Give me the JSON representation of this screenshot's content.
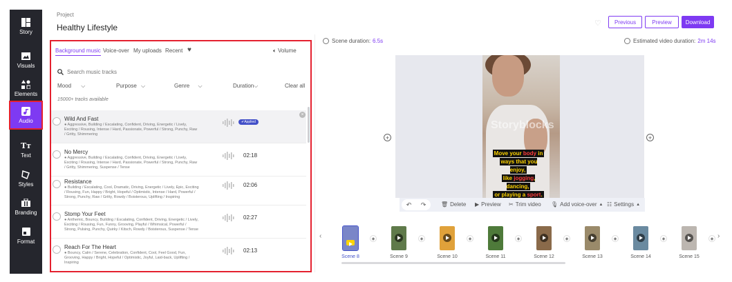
{
  "sidebar": {
    "items": [
      {
        "label": "Story",
        "icon": "story-icon"
      },
      {
        "label": "Visuals",
        "icon": "image-icon"
      },
      {
        "label": "Elements",
        "icon": "shapes-icon"
      },
      {
        "label": "Audio",
        "icon": "music-note-icon",
        "active": true
      },
      {
        "label": "Text",
        "icon": "text-icon"
      },
      {
        "label": "Styles",
        "icon": "brush-icon"
      },
      {
        "label": "Branding",
        "icon": "briefcase-icon"
      },
      {
        "label": "Format",
        "icon": "aspect-ratio-icon"
      }
    ]
  },
  "header": {
    "project_label": "Project",
    "project_title": "Healthy Lifestyle",
    "btn_previous": "Previous",
    "btn_preview": "Preview",
    "btn_download": "Download"
  },
  "audio_panel": {
    "tabs": [
      "Background music",
      "Voice-over",
      "My uploads",
      "Recent"
    ],
    "volume_label": "Volume",
    "search_placeholder": "Search music tracks",
    "filters": {
      "mood": "Mood",
      "purpose": "Purpose",
      "genre": "Genre",
      "duration": "Duration",
      "clear": "Clear all"
    },
    "count": "15000+ tracks available",
    "applied_label": "Applied",
    "tracks": [
      {
        "title": "Wild And Fast",
        "tags": "● Aggressive, Building / Escalating, Confident, Driving, Energetic / Lively, Exciting / Rousing, Intense / Hard, Passionate, Powerful / Strong, Punchy, Raw / Gritty, Shimmering",
        "duration": "",
        "applied": true
      },
      {
        "title": "No Mercy",
        "tags": "● Aggressive, Building / Escalating, Confident, Driving, Energetic / Lively, Exciting / Rousing, Intense / Hard, Passionate, Powerful / Strong, Punchy, Raw / Gritty, Shimmering, Suspense / Tense",
        "duration": "02:18"
      },
      {
        "title": "Resistance",
        "tags": "● Building / Escalating, Cool, Dramatic, Driving, Energetic / Lively, Epic, Exciting / Rousing, Fun, Happy / Bright, Hopeful / Optimistic, Intense / Hard, Powerful / Strong, Punchy, Raw / Gritty, Rowdy / Boisterous, Uplifting / Inspiring",
        "duration": "02:06"
      },
      {
        "title": "Stomp Your Feet",
        "tags": "● Anthemic, Bouncy, Building / Escalating, Confident, Driving, Energetic / Lively, Exciting / Rousing, Fun, Funny, Grooving, Playful / Whimsical, Powerful / Strong, Pulsing, Punchy, Quirky / Kitsch, Rowdy / Boisterous, Suspense / Tense",
        "duration": "02:27"
      },
      {
        "title": "Reach For The Heart",
        "tags": "● Bouncy, Calm / Serene, Celebration, Confident, Cool, Feel Good, Fun, Grooving, Happy / Bright, Hopeful / Optimistic, Joyful, Laid-back, Uplifting / Inspiring",
        "duration": "02:13"
      }
    ]
  },
  "editor": {
    "scene_duration_label": "Scene duration:",
    "scene_duration": "6.5s",
    "est_duration_label": "Estimated video duration:",
    "est_duration": "2m 14s",
    "watermark": "Storyblocks",
    "caption": {
      "l1a": "Move your ",
      "l1b": "body",
      "l1c": " in",
      "l2": "ways that you enjoy,",
      "l3a": "like ",
      "l3b": "jogging",
      "l3c": ", dancing,",
      "l4a": "or playing a ",
      "l4b": "sport",
      "l4c": "."
    },
    "toolbar": {
      "delete": "Delete",
      "preview": "Preview",
      "trim": "Trim video",
      "voiceover": "Add voice-over",
      "settings": "Settings"
    }
  },
  "timeline": {
    "scenes": [
      {
        "label": "Scene 8",
        "color": "#7a86c8",
        "active": true
      },
      {
        "label": "Scene 9",
        "color": "#5f7a4a"
      },
      {
        "label": "Scene 10",
        "color": "#e0a13a"
      },
      {
        "label": "Scene 11",
        "color": "#4e7a3a"
      },
      {
        "label": "Scene 12",
        "color": "#8a6a4a"
      },
      {
        "label": "Scene 13",
        "color": "#9a8a6a"
      },
      {
        "label": "Scene 14",
        "color": "#6a8aa0"
      },
      {
        "label": "Scene 15",
        "color": "#bcb6b0"
      }
    ]
  },
  "colors": {
    "accent": "#7e3af2",
    "sidebar": "#25262d",
    "highlight_border": "#e4202e",
    "applied_badge": "#4250c8"
  }
}
